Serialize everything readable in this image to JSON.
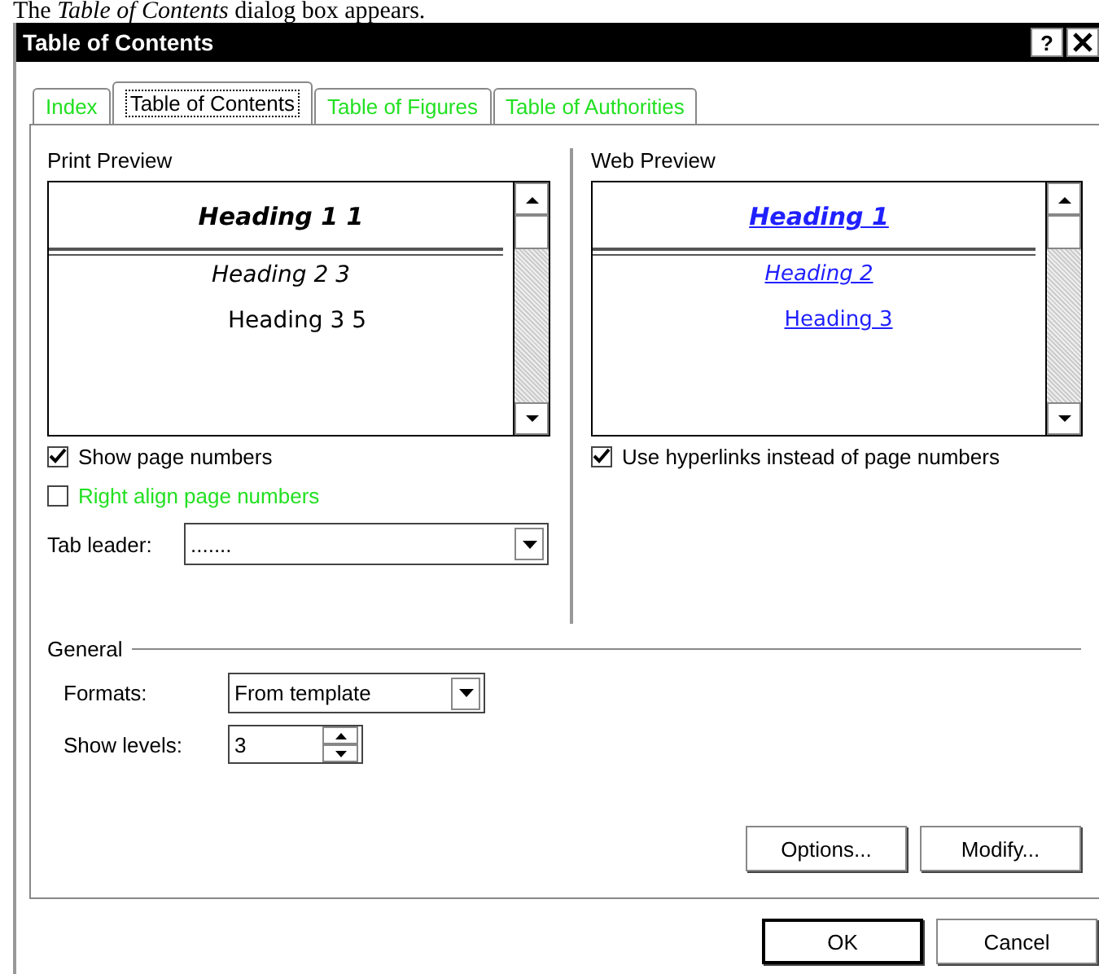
{
  "caption": "The *Table of Contents* dialog box appears.",
  "window": {
    "title": "Table of Contents",
    "help": "?"
  },
  "tabs": [
    {
      "label": "Index",
      "selected": false
    },
    {
      "label": "Table of Contents",
      "selected": true
    },
    {
      "label": "Table of Figures",
      "selected": false
    },
    {
      "label": "Table of Authorities",
      "selected": false
    }
  ],
  "print_preview": {
    "label": "Print Preview",
    "entries": [
      {
        "kind": "h1",
        "text": "Heading 1 1"
      },
      {
        "kind": "h2",
        "text": "Heading 2 3"
      },
      {
        "kind": "h3",
        "text": "Heading 3 5"
      }
    ]
  },
  "print_options": [
    {
      "label": "Show page numbers",
      "checked": true,
      "disabled": false
    },
    {
      "label": "Right align page numbers",
      "checked": false,
      "disabled": true
    }
  ],
  "tab_leader": {
    "label": "Tab leader:",
    "value": "......."
  },
  "web_preview": {
    "label": "Web Preview",
    "entries": [
      {
        "kind": "h1",
        "text": "Heading 1"
      },
      {
        "kind": "h2",
        "text": "Heading 2"
      },
      {
        "kind": "h3",
        "text": "Heading 3"
      }
    ]
  },
  "web_options": [
    {
      "label": "Use hyperlinks instead of page numbers",
      "checked": true,
      "disabled": false
    }
  ],
  "general": {
    "title": "General",
    "formats": {
      "label": "Formats:",
      "value": "From template"
    },
    "show_levels": {
      "label": "Show levels:",
      "value": "3"
    }
  },
  "panel_buttons": [
    "Options...",
    "Modify..."
  ],
  "footer_buttons": [
    "OK",
    "Cancel"
  ]
}
